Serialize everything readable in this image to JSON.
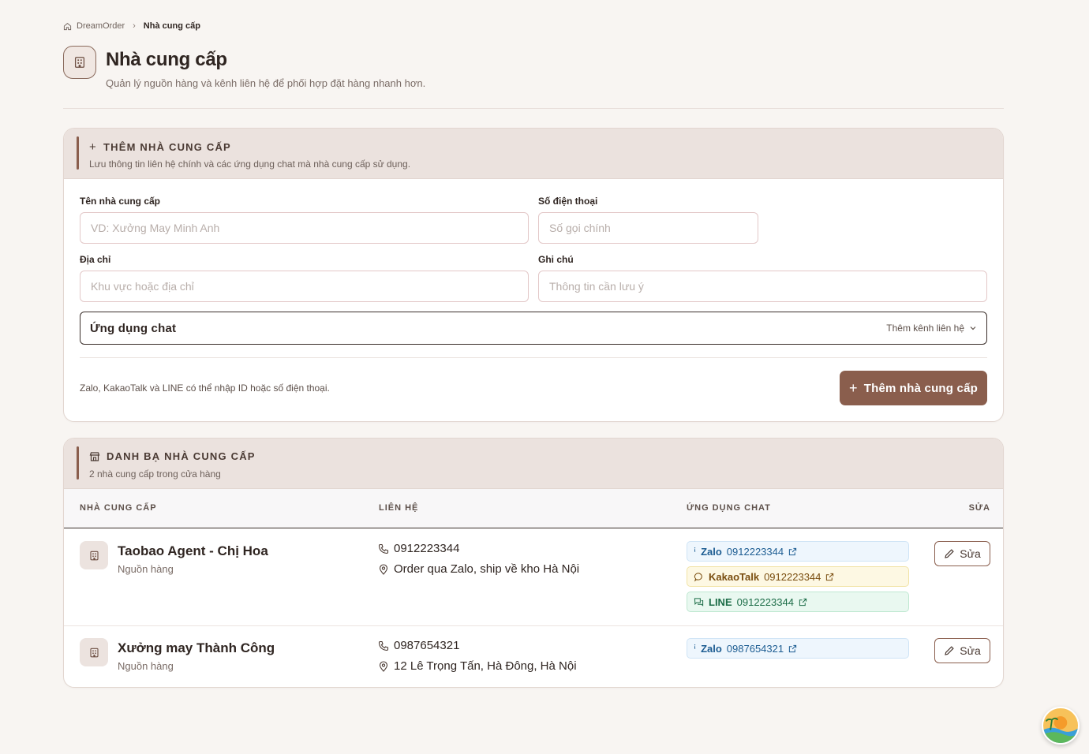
{
  "breadcrumb": {
    "root": "DreamOrder",
    "current": "Nhà cung cấp"
  },
  "header": {
    "title": "Nhà cung cấp",
    "subtitle": "Quản lý nguồn hàng và kênh liên hệ để phối hợp đặt hàng nhanh hơn."
  },
  "add_form": {
    "title": "THÊM NHÀ CUNG CẤP",
    "description": "Lưu thông tin liên hệ chính và các ứng dụng chat mà nhà cung cấp sử dụng.",
    "name_label": "Tên nhà cung cấp",
    "name_placeholder": "VD: Xưởng May Minh Anh",
    "phone_label": "Số điện thoại",
    "phone_placeholder": "Số gọi chính",
    "address_label": "Địa chỉ",
    "address_placeholder": "Khu vực hoặc địa chỉ",
    "note_label": "Ghi chú",
    "note_placeholder": "Thông tin cần lưu ý",
    "chat_label": "Ứng dụng chat",
    "chat_add": "Thêm kênh liên hệ",
    "hint": "Zalo, KakaoTalk và LINE có thể nhập ID hoặc số điện thoại.",
    "submit": "Thêm nhà cung cấp"
  },
  "directory": {
    "title": "DANH BẠ NHÀ CUNG CẤP",
    "count_text": "2 nhà cung cấp trong cửa hàng",
    "columns": [
      "NHÀ CUNG CẤP",
      "LIÊN HỆ",
      "ỨNG DỤNG CHAT",
      "SỬA"
    ],
    "rows": [
      {
        "name": "Taobao Agent - Chị Hoa",
        "type": "Nguồn hàng",
        "phone": "0912223344",
        "address": "Order qua Zalo, ship về kho Hà Nội",
        "chats": [
          {
            "app": "Zalo",
            "id": "0912223344"
          },
          {
            "app": "KakaoTalk",
            "id": "0912223344"
          },
          {
            "app": "LINE",
            "id": "0912223344"
          }
        ],
        "edit": "Sửa"
      },
      {
        "name": "Xưởng may Thành Công",
        "type": "Nguồn hàng",
        "phone": "0987654321",
        "address": "12 Lê Trọng Tấn, Hà Đông, Hà Nội",
        "chats": [
          {
            "app": "Zalo",
            "id": "0987654321"
          }
        ],
        "edit": "Sửa"
      }
    ]
  },
  "colors": {
    "accent": "#8a5e4d",
    "header_bg": "#ebe2de",
    "page_bg": "#f8f5f2"
  }
}
